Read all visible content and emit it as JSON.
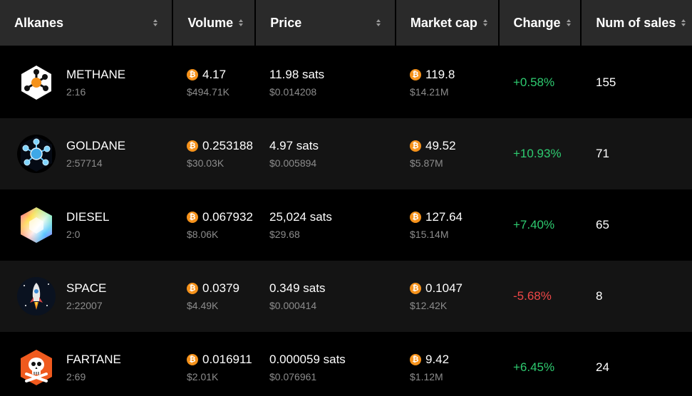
{
  "headers": {
    "alkanes": "Alkanes",
    "volume": "Volume",
    "price": "Price",
    "market_cap": "Market cap",
    "change": "Change",
    "num_sales": "Num of sales"
  },
  "currency_symbol": "₿",
  "colors": {
    "positive": "#2ecb70",
    "negative": "#ef4747",
    "btc": "#f5921b"
  },
  "rows": [
    {
      "name": "METHANE",
      "id": "2:16",
      "volume_btc": "4.17",
      "volume_usd": "$494.71K",
      "price_sats": "11.98 sats",
      "price_usd": "$0.014208",
      "mcap_btc": "119.8",
      "mcap_usd": "$14.21M",
      "change": "+0.58%",
      "sales": "155",
      "icon": "methane-molecule-icon"
    },
    {
      "name": "GOLDANE",
      "id": "2:57714",
      "volume_btc": "0.253188",
      "volume_usd": "$30.03K",
      "price_sats": "4.97 sats",
      "price_usd": "$0.005894",
      "mcap_btc": "49.52",
      "mcap_usd": "$5.87M",
      "change": "+10.93%",
      "sales": "71",
      "icon": "crystal-molecule-icon"
    },
    {
      "name": "DIESEL",
      "id": "2:0",
      "volume_btc": "0.067932",
      "volume_usd": "$8.06K",
      "price_sats": "25,024 sats",
      "price_usd": "$29.68",
      "mcap_btc": "127.64",
      "mcap_usd": "$15.14M",
      "change": "+7.40%",
      "sales": "65",
      "icon": "rainbow-hexagon-icon"
    },
    {
      "name": "SPACE",
      "id": "2:22007",
      "volume_btc": "0.0379",
      "volume_usd": "$4.49K",
      "price_sats": "0.349 sats",
      "price_usd": "$0.000414",
      "mcap_btc": "0.1047",
      "mcap_usd": "$12.42K",
      "change": "-5.68%",
      "sales": "8",
      "icon": "rocket-icon"
    },
    {
      "name": "FARTANE",
      "id": "2:69",
      "volume_btc": "0.016911",
      "volume_usd": "$2.01K",
      "price_sats": "0.000059 sats",
      "price_usd": "$0.076961",
      "mcap_btc": "9.42",
      "mcap_usd": "$1.12M",
      "change": "+6.45%",
      "sales": "24",
      "icon": "skull-crossbones-icon"
    }
  ]
}
